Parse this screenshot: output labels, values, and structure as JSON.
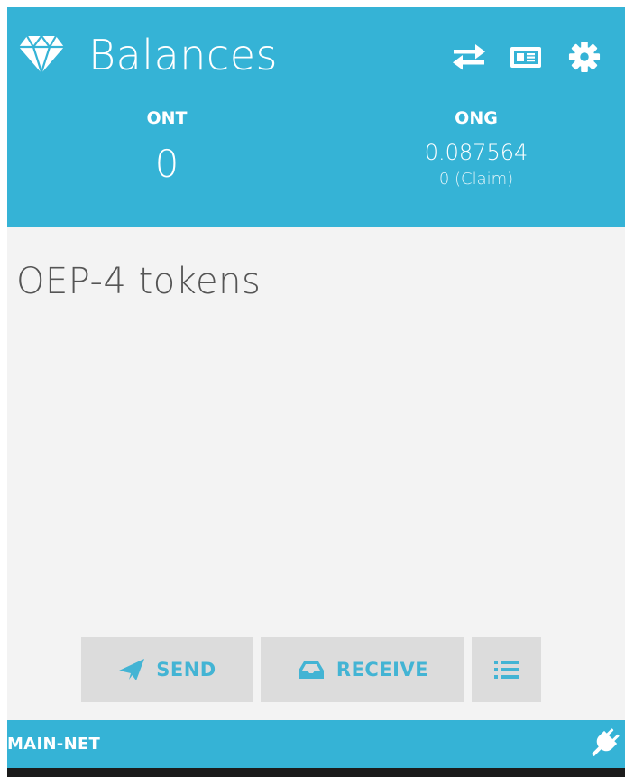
{
  "header": {
    "title": "Balances",
    "icons": {
      "logo": "diamond-icon",
      "transfer": "transfer-arrows-icon",
      "identity": "id-card-icon",
      "settings": "gear-icon"
    },
    "colors": {
      "accent": "#35b3d6",
      "text": "#ffffff"
    }
  },
  "balances": {
    "ont": {
      "label": "ONT",
      "value": "0"
    },
    "ong": {
      "label": "ONG",
      "value": "0.087564",
      "claim": "0 (Claim)"
    }
  },
  "tokens": {
    "title": "OEP-4 tokens"
  },
  "actions": {
    "send_label": "SEND",
    "receive_label": "RECEIVE",
    "icons": {
      "send": "paper-plane-icon",
      "receive": "inbox-icon",
      "list": "list-icon"
    },
    "colors": {
      "button_bg": "#dcdcdc",
      "button_text": "#43b4d4"
    }
  },
  "footer": {
    "network": "MAIN-NET",
    "icon": "plug-icon"
  }
}
